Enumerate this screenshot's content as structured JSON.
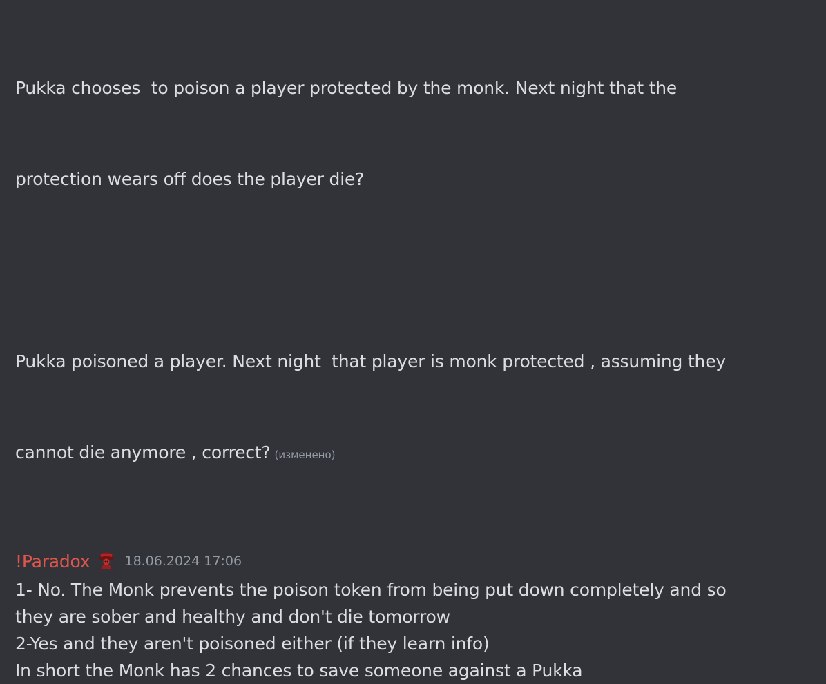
{
  "messages": {
    "first": {
      "paragraph_1": [
        "Pukka chooses  to poison a player protected by the monk. Next night that the",
        "protection wears off does the player die?"
      ],
      "paragraph_2": [
        "Pukka poisoned a player. Next night  that player is monk protected , assuming they",
        "cannot die anymore , correct?"
      ],
      "edited_label": "(изменено)"
    },
    "reply": {
      "username": "!Paradox",
      "role_icon": "hat-avatar-icon",
      "timestamp": "18.06.2024 17:06",
      "lines": [
        "1- No. The Monk prevents the poison token from being put down completely and so",
        "they are sober and healthy and don't die tomorrow",
        "2-Yes and they aren't poisoned either (if they learn info)",
        "In short the Monk has 2 chances to save someone against a Pukka"
      ]
    }
  },
  "colors": {
    "background": "#313338",
    "text": "#dbdee1",
    "username": "#e0564d",
    "muted": "#949ba4"
  }
}
